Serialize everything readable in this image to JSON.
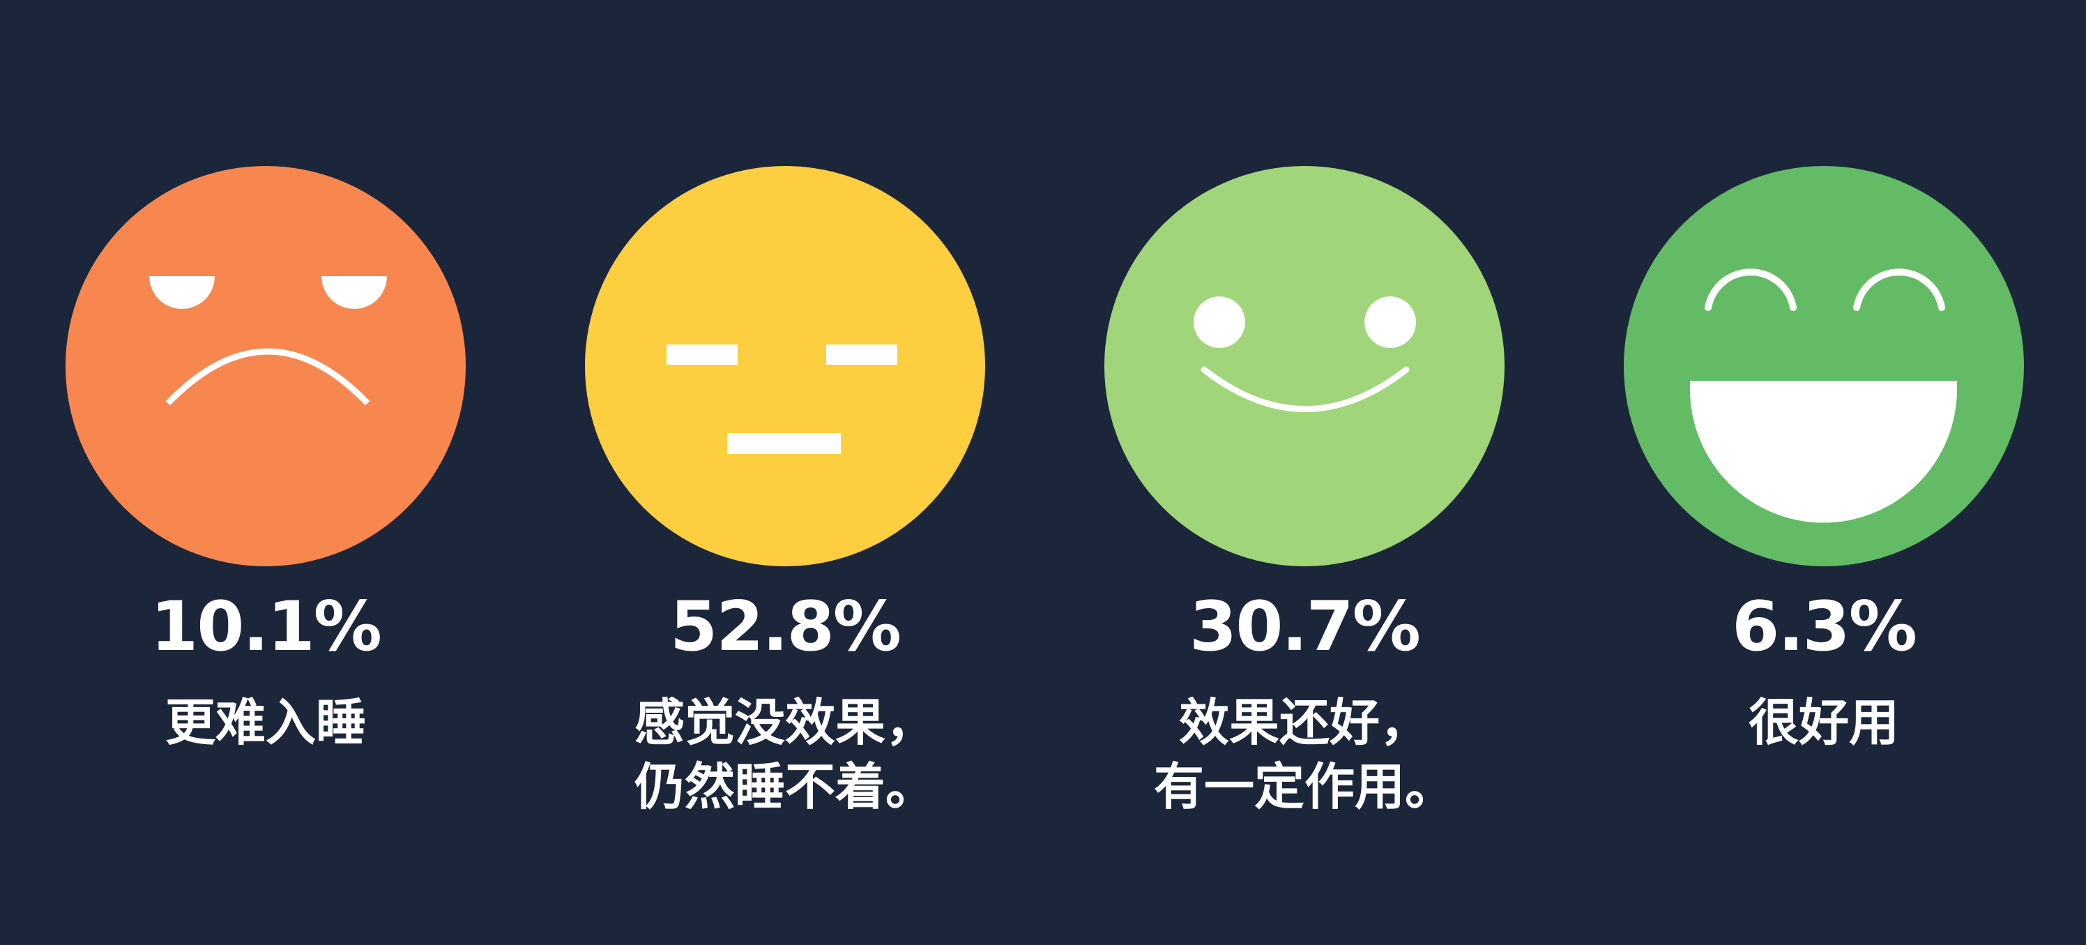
{
  "items": [
    {
      "percent": "10.1%",
      "description_lines": [
        "更难入睡"
      ],
      "face_color": "#f8874f",
      "expression": "angry-face-icon"
    },
    {
      "percent": "52.8%",
      "description_lines": [
        "感觉没效果，",
        "仍然睡不着。"
      ],
      "face_color": "#fdce40",
      "expression": "neutral-face-icon"
    },
    {
      "percent": "30.7%",
      "description_lines": [
        "效果还好，",
        "有一定作用。"
      ],
      "face_color": "#a0d57a",
      "expression": "smiling-face-icon"
    },
    {
      "percent": "6.3%",
      "description_lines": [
        "很好用"
      ],
      "face_color": "#64bb65",
      "expression": "laughing-face-icon"
    }
  ]
}
